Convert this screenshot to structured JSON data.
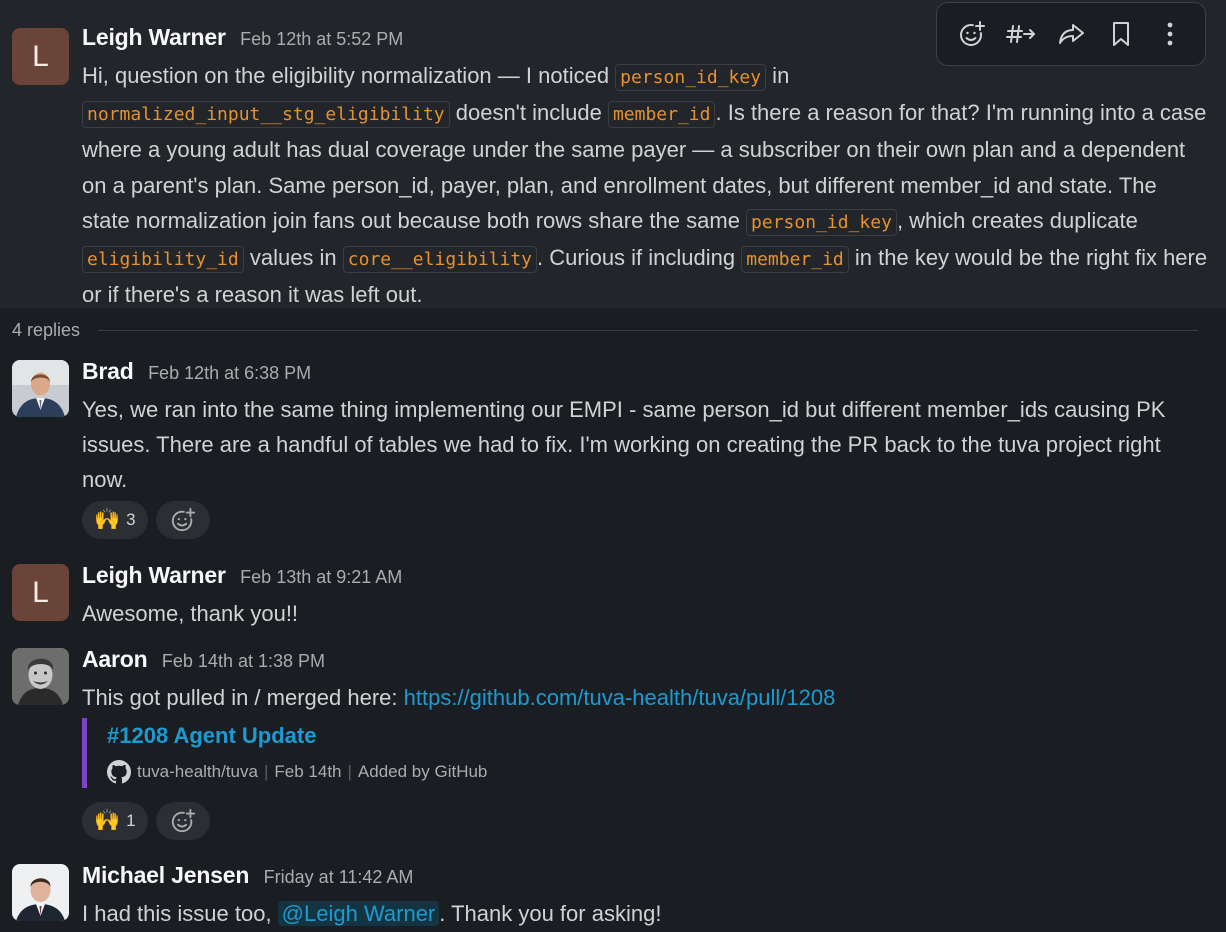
{
  "parent": {
    "avatar_letter": "L",
    "author": "Leigh Warner",
    "time": "Feb 12th at 5:52 PM",
    "t1": "Hi, question on the eligibility normalization — I noticed ",
    "c1": "person_id_key",
    "t2": " in",
    "c2": "normalized_input__stg_eligibility",
    "t3": " doesn't include ",
    "c3": "member_id",
    "t4": ". Is there a reason for that? I'm running into a case where a young adult has dual coverage under the same payer — a subscriber on their own plan and a dependent on a parent's plan. Same person_id, payer, plan, and enrollment dates, but different member_id and state. The state normalization join fans out because both rows share the same ",
    "c4": "person_id_key",
    "t5": ", which creates duplicate ",
    "c5": "eligibility_id",
    "t6": " values in ",
    "c6": "core__eligibility",
    "t7": ". Curious if including ",
    "c7": "member_id",
    "t8": " in the key would be the right fix here or if there's a reason it was left out."
  },
  "toolbar": {
    "icons": [
      "add-reaction-icon",
      "reply-in-channel-icon",
      "share-icon",
      "bookmark-icon",
      "more-icon"
    ]
  },
  "thread": {
    "replies_label": "4 replies"
  },
  "replies": [
    {
      "author": "Brad",
      "time": "Feb 12th at 6:38 PM",
      "text": "Yes, we ran into the same thing implementing our EMPI - same person_id but different member_ids causing PK issues. There are a handful of tables we had to fix. I'm working on creating the PR back to the tuva project right now.",
      "reaction_emoji": "🙌",
      "reaction_count": "3"
    },
    {
      "avatar_letter": "L",
      "author": "Leigh Warner",
      "time": "Feb 13th at 9:21 AM",
      "text": "Awesome, thank you!!"
    },
    {
      "author": "Aaron",
      "time": "Feb 14th at 1:38 PM",
      "text_prefix": "This got pulled in / merged here: ",
      "link": "https://github.com/tuva-health/tuva/pull/1208",
      "unfurl": {
        "title": "#1208 Agent Update",
        "repo": "tuva-health/tuva",
        "date": "Feb 14th",
        "added_by": "Added by GitHub",
        "accent_color": "#7b44c3"
      },
      "reaction_emoji": "🙌",
      "reaction_count": "1"
    },
    {
      "author": "Michael Jensen",
      "time": "Friday at 11:42 AM",
      "text_prefix": "I had this issue too, ",
      "mention": "@Leigh Warner",
      "text_suffix": ". Thank you for asking!"
    }
  ],
  "colors": {
    "background": "#1a1d21",
    "code_text": "#e8912d",
    "link": "#1d9bd1"
  }
}
